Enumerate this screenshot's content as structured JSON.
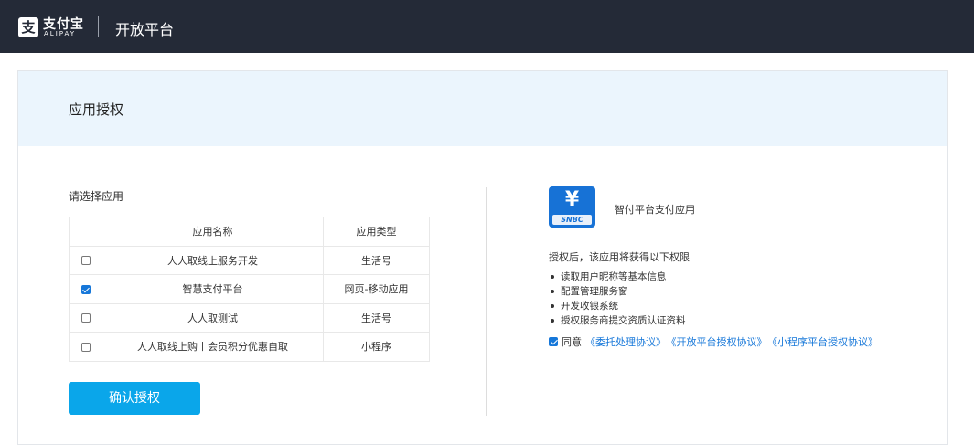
{
  "header": {
    "logo_mark": "支",
    "logo_cn": "支付宝",
    "logo_en": "ALIPAY",
    "platform_title": "开放平台"
  },
  "page": {
    "title": "应用授权"
  },
  "app_select": {
    "label": "请选择应用",
    "columns": [
      "应用名称",
      "应用类型"
    ],
    "rows": [
      {
        "name": "人人取线上服务开发",
        "type": "生活号",
        "checked": false
      },
      {
        "name": "智慧支付平台",
        "type": "网页-移动应用",
        "checked": true
      },
      {
        "name": "人人取测试",
        "type": "生活号",
        "checked": false
      },
      {
        "name": "人人取线上购丨会员积分优惠自取",
        "type": "小程序",
        "checked": false
      }
    ],
    "confirm_label": "确认授权"
  },
  "app_info": {
    "icon_symbol": "¥",
    "icon_text": "SNBC",
    "name": "智付平台支付应用",
    "permissions_title": "授权后，该应用将获得以下权限",
    "permissions": [
      "读取用户昵称等基本信息",
      "配置管理服务窗",
      "开发收银系统",
      "授权服务商提交资质认证资料"
    ]
  },
  "agreement": {
    "checked": true,
    "text": "同意",
    "links": [
      "《委托处理协议》",
      "《开放平台授权协议》",
      "《小程序平台授权协议》"
    ]
  },
  "colors": {
    "header_bg": "#242a37",
    "accent": "#0aa6ea",
    "link": "#1677d9",
    "head_bg": "#ebf5fd"
  }
}
